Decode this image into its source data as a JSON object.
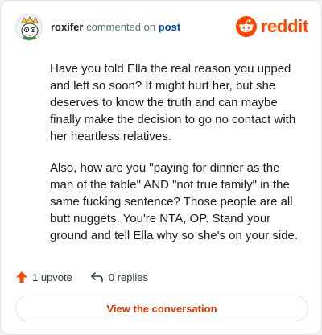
{
  "header": {
    "username": "roxifer",
    "action_text": "commented on",
    "post_link": "post",
    "brand": "reddit"
  },
  "comment": {
    "paragraphs": [
      "Have you told Ella the real reason you upped and left so soon? It might hurt her, but she deserves to know the truth and can maybe finally make the decision to go no contact with her heartless relatives.",
      "Also, how are you \"paying for dinner as the man of the table\" AND \"not true family\" in the same fucking sentence? Those people are all butt nuggets. You're NTA, OP. Stand your ground and tell Ella why so she's on your side."
    ]
  },
  "footer": {
    "upvotes": "1 upvote",
    "replies": "0 replies"
  },
  "cta": {
    "label": "View the conversation"
  },
  "colors": {
    "brand": "#ff4500",
    "link": "#0045ac",
    "cta": "#d93900"
  },
  "icons": [
    "avatar",
    "reddit-logo-icon",
    "upvote-icon",
    "reply-icon"
  ]
}
